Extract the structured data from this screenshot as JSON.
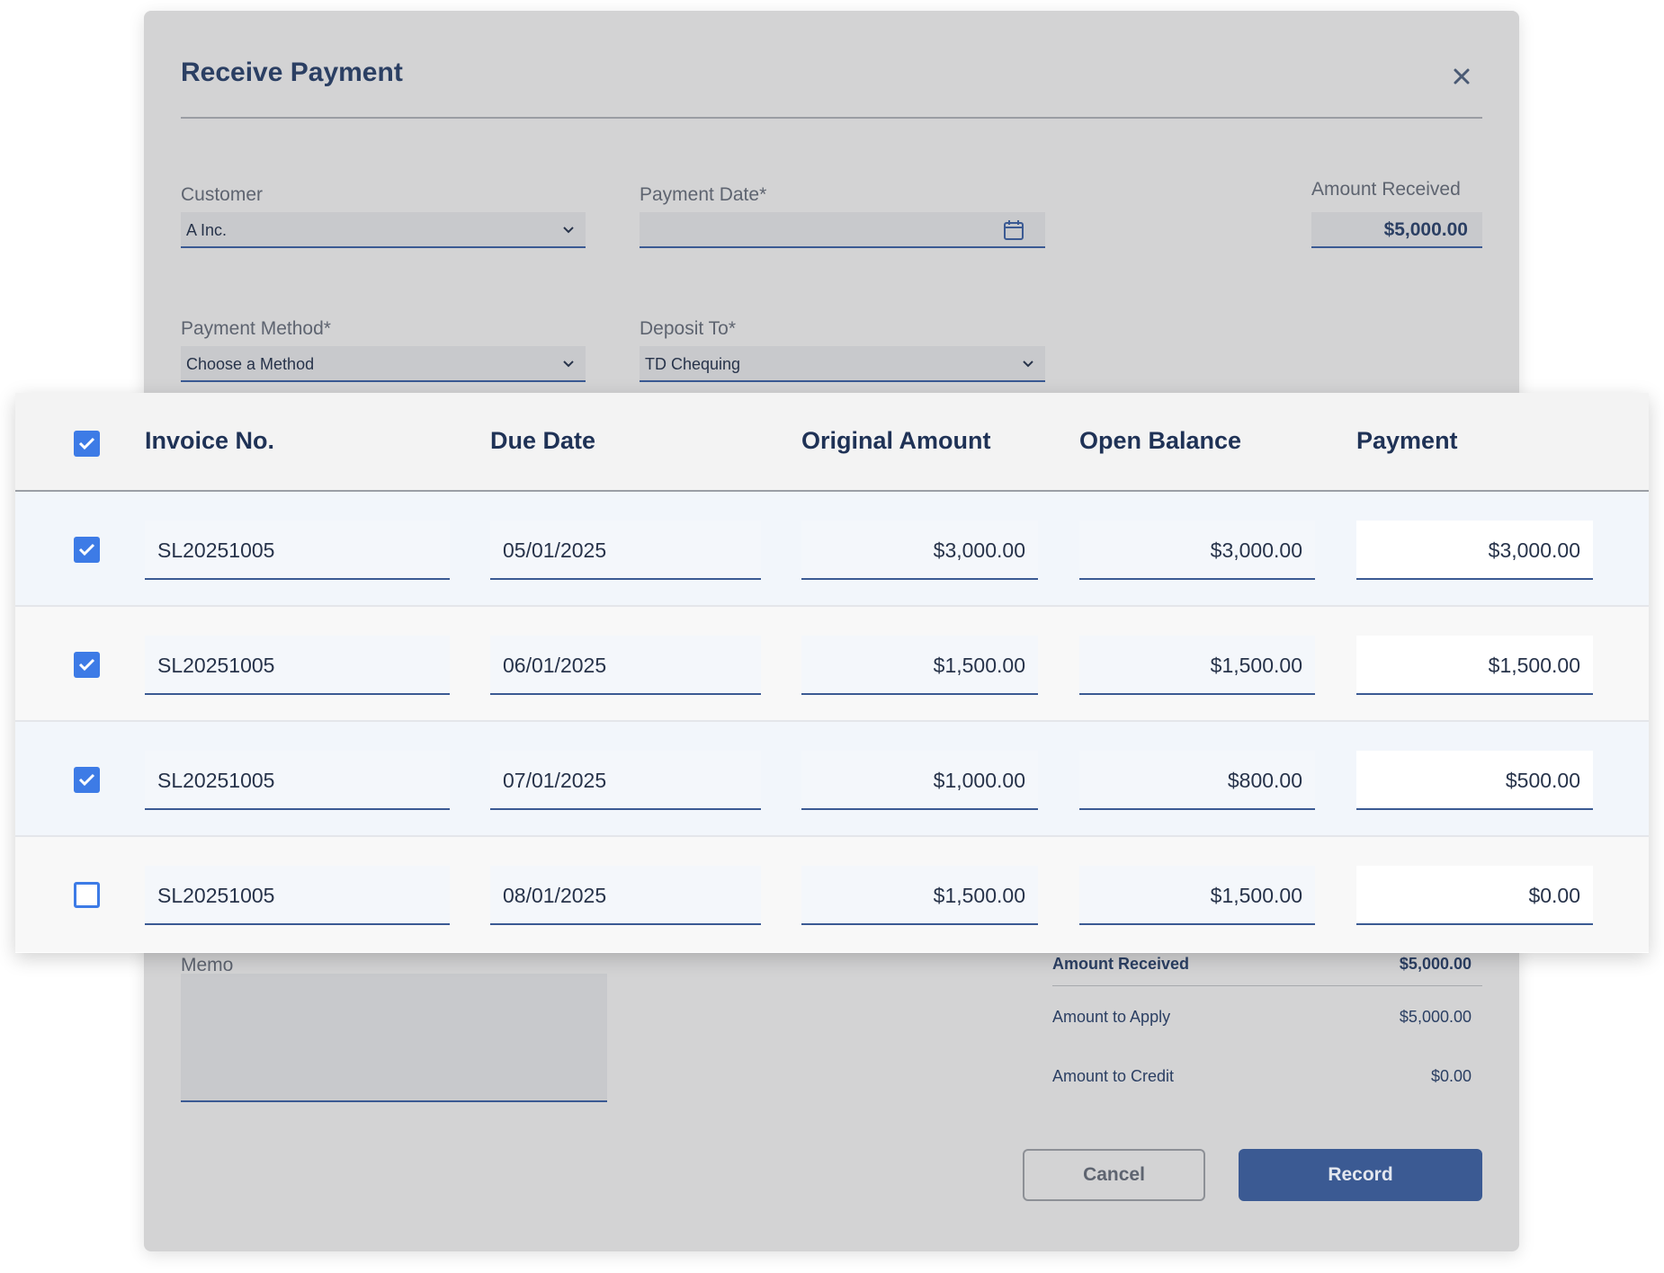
{
  "modal": {
    "title": "Receive Payment",
    "close_icon": "close-icon"
  },
  "form": {
    "customer": {
      "label": "Customer",
      "value": "A Inc."
    },
    "payment_date": {
      "label": "Payment Date*",
      "value": ""
    },
    "amount_received": {
      "label": "Amount Received",
      "value": "$5,000.00"
    },
    "payment_method": {
      "label": "Payment Method*",
      "value": "Choose a Method"
    },
    "deposit_to": {
      "label": "Deposit To*",
      "value": "TD Chequing"
    }
  },
  "table": {
    "header_checked": true,
    "columns": [
      "Invoice No.",
      "Due Date",
      "Original Amount",
      "Open Balance",
      "Payment"
    ],
    "rows": [
      {
        "checked": true,
        "invoice": "SL20251005",
        "due": "05/01/2025",
        "original": "$3,000.00",
        "open": "$3,000.00",
        "payment": "$3,000.00"
      },
      {
        "checked": true,
        "invoice": "SL20251005",
        "due": "06/01/2025",
        "original": "$1,500.00",
        "open": "$1,500.00",
        "payment": "$1,500.00"
      },
      {
        "checked": true,
        "invoice": "SL20251005",
        "due": "07/01/2025",
        "original": "$1,000.00",
        "open": "$800.00",
        "payment": "$500.00"
      },
      {
        "checked": false,
        "invoice": "SL20251005",
        "due": "08/01/2025",
        "original": "$1,500.00",
        "open": "$1,500.00",
        "payment": "$0.00"
      }
    ]
  },
  "memo": {
    "label": "Memo"
  },
  "summary": {
    "amount_received": {
      "label": "Amount Received",
      "value": "$5,000.00"
    },
    "amount_to_apply": {
      "label": "Amount to Apply",
      "value": "$5,000.00"
    },
    "amount_to_credit": {
      "label": "Amount to Credit",
      "value": "$0.00"
    }
  },
  "actions": {
    "cancel": "Cancel",
    "record": "Record"
  },
  "colors": {
    "accent": "#3b5a93",
    "checkbox": "#3d7be6",
    "title": "#2b3f63"
  }
}
